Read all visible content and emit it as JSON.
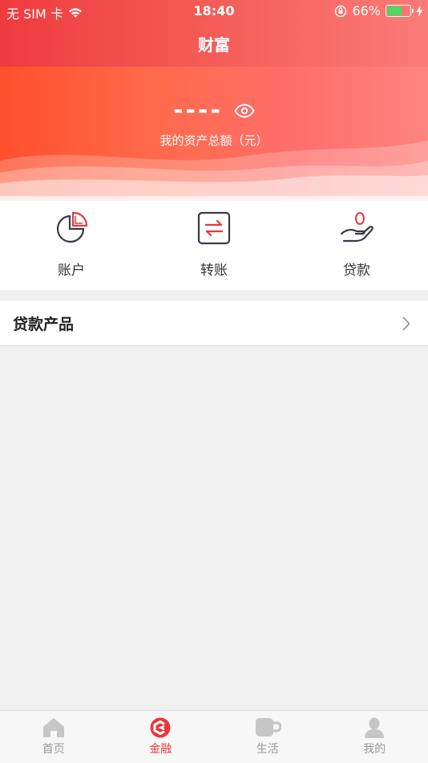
{
  "status_bar": {
    "carrier": "无 SIM 卡",
    "time": "18:40",
    "battery_percent": "66%",
    "battery_level": 0.66
  },
  "header": {
    "title": "财富"
  },
  "assets": {
    "masked_value": "----",
    "label": "我的资产总额（元）"
  },
  "quick_actions": [
    {
      "label": "账户",
      "icon": "pie-chart-icon"
    },
    {
      "label": "转账",
      "icon": "transfer-icon"
    },
    {
      "label": "贷款",
      "icon": "hand-coin-icon"
    }
  ],
  "loan_products": {
    "title": "贷款产品"
  },
  "tab_bar": {
    "items": [
      {
        "label": "首页",
        "icon": "home-icon",
        "active": false
      },
      {
        "label": "金融",
        "icon": "finance-logo-icon",
        "active": true
      },
      {
        "label": "生活",
        "icon": "cup-icon",
        "active": false
      },
      {
        "label": "我的",
        "icon": "user-icon",
        "active": false
      }
    ]
  },
  "colors": {
    "accent": "#e8383d",
    "hero_left": "#ff4f2d",
    "hero_right": "#ff8580",
    "inactive_tab": "#999999"
  }
}
